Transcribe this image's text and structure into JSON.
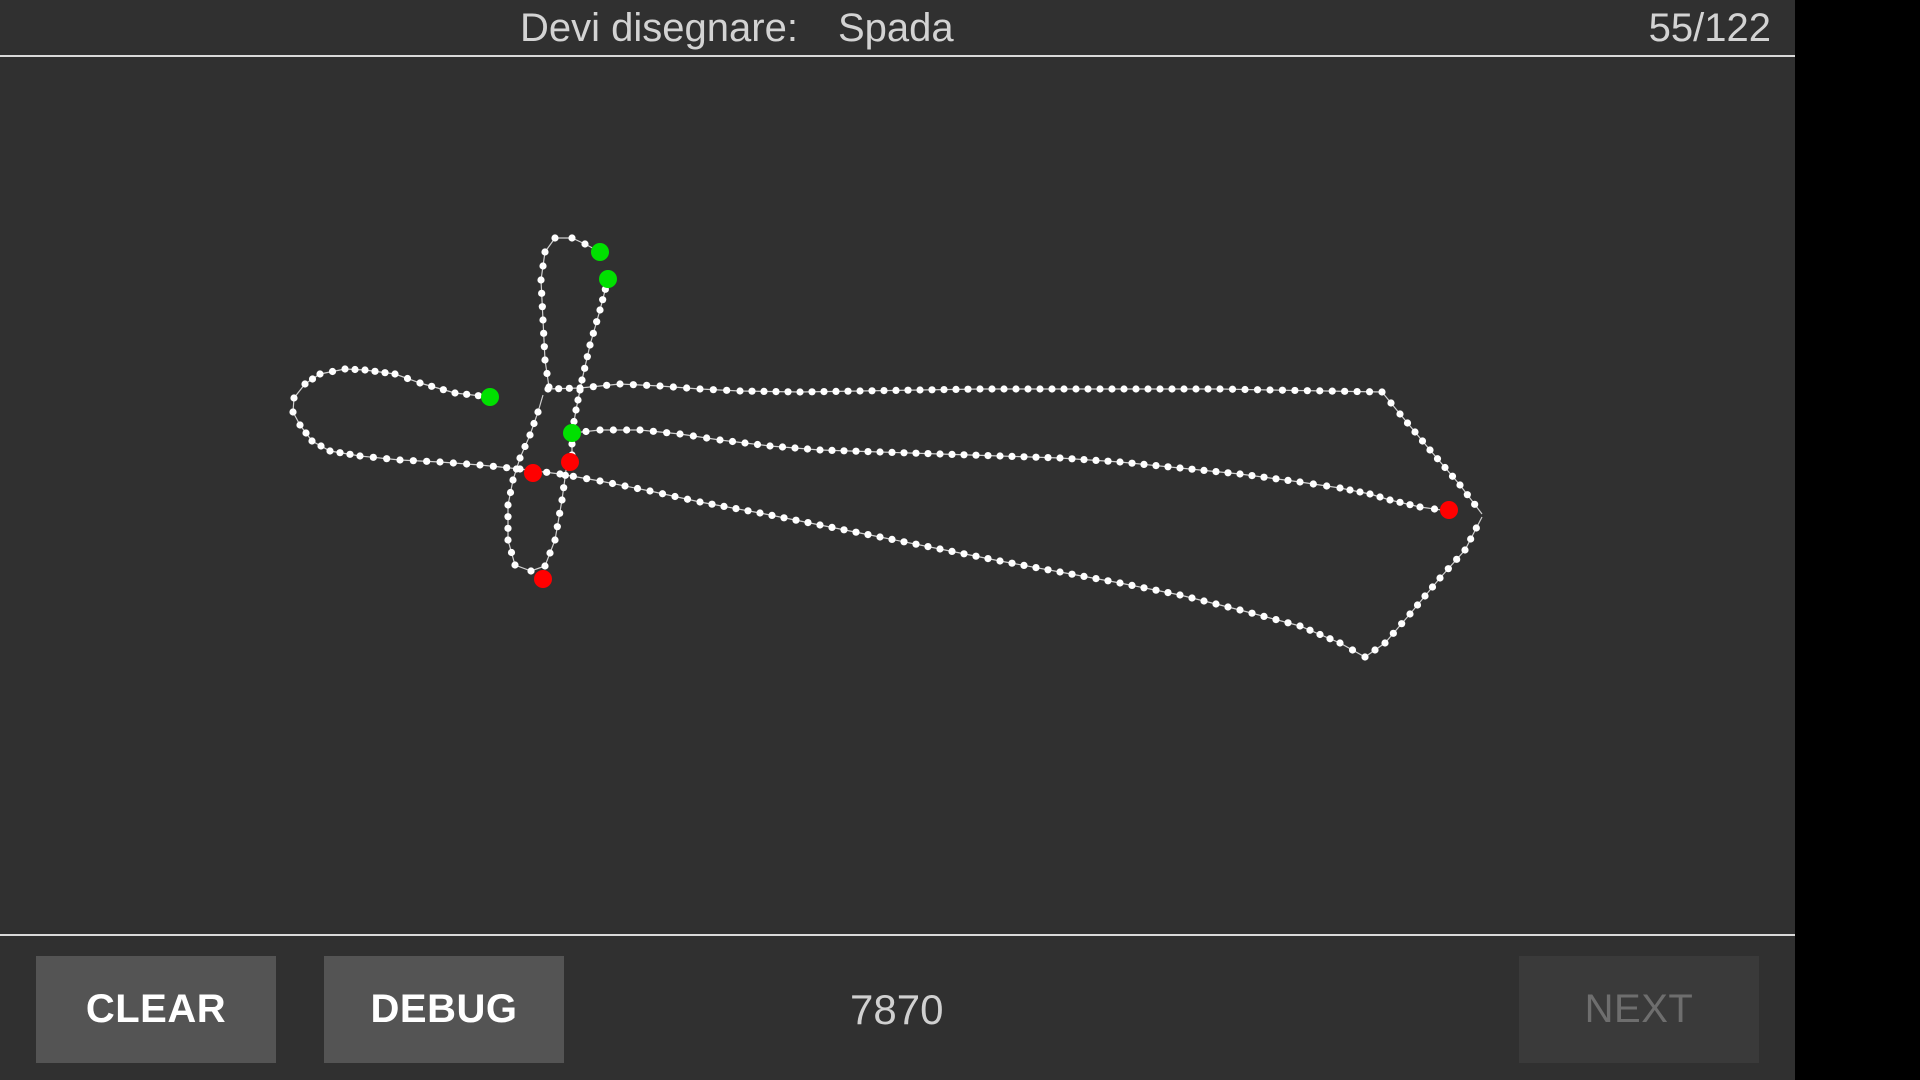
{
  "header": {
    "prompt_label": "Devi disegnare:",
    "prompt_word": "Spada",
    "counter": "55/122"
  },
  "footer": {
    "clear_label": "CLEAR",
    "debug_label": "DEBUG",
    "score": "7870",
    "next_label": "NEXT"
  },
  "colors": {
    "background": "#303030",
    "stroke": "#ffffff",
    "stroke_start": "#00e000",
    "stroke_end": "#ff0000"
  }
}
